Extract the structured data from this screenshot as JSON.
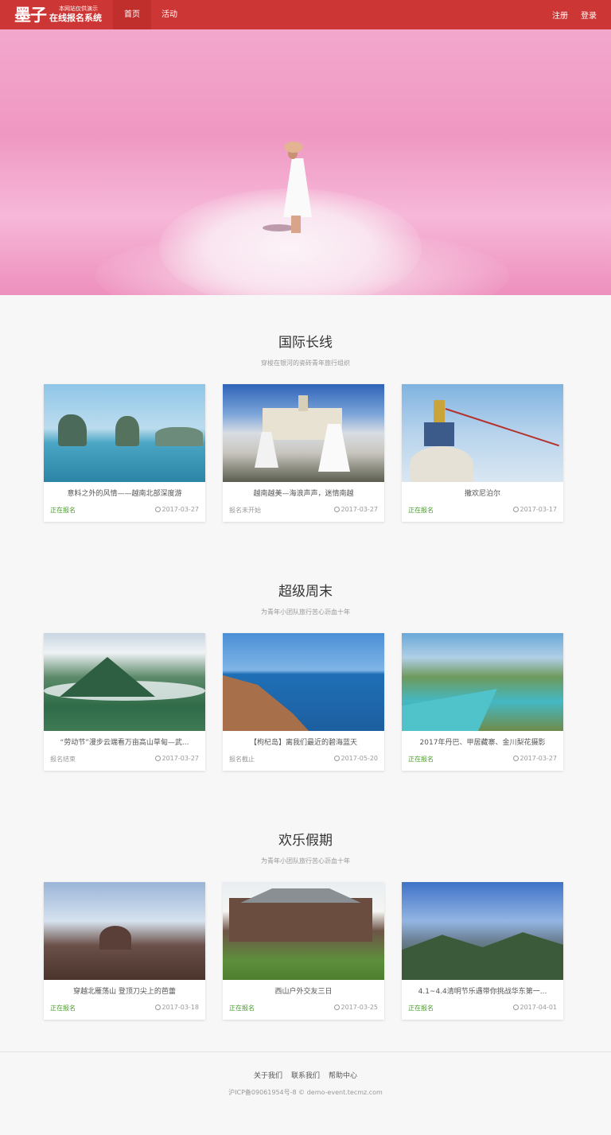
{
  "nav": {
    "logo": "墨子",
    "brand_small": "本网站仅供演示",
    "brand_big": "在线报名系统",
    "items": [
      {
        "label": "首页"
      },
      {
        "label": "活动"
      }
    ],
    "right": [
      {
        "label": "注册"
      },
      {
        "label": "登录"
      }
    ]
  },
  "colors": {
    "brand": "#cc3634",
    "status_open": "#4a9a2e",
    "status_closed": "#999999"
  },
  "sections": [
    {
      "title": "国际长线",
      "subtitle": "穿梭在银河的瓷砖青年旅行组织",
      "cards": [
        {
          "title": "意料之外的风情——越南北部深度游",
          "status": "正在报名",
          "date": "2017-03-27"
        },
        {
          "title": "越南越美—海浪声声，迷情南越",
          "status": "报名未开始",
          "date": "2017-03-27"
        },
        {
          "title": "撒欢尼泊尔",
          "status": "正在报名",
          "date": "2017-03-17"
        }
      ]
    },
    {
      "title": "超级周末",
      "subtitle": "为青年小团队旅行苦心沥血十年",
      "cards": [
        {
          "title": "“劳动节”漫步云端看万亩高山草甸—武...",
          "status": "报名结束",
          "date": "2017-03-27"
        },
        {
          "title": "【枸杞岛】离我们最近的碧海蓝天",
          "status": "报名截止",
          "date": "2017-05-20"
        },
        {
          "title": "2017年丹巴、甲居藏寨、金川梨花摄影",
          "status": "正在报名",
          "date": "2017-03-27"
        }
      ]
    },
    {
      "title": "欢乐假期",
      "subtitle": "为青年小团队旅行苦心沥血十年",
      "cards": [
        {
          "title": "穿越北雁荡山 登顶刀尖上的芭蕾",
          "status": "正在报名",
          "date": "2017-03-18"
        },
        {
          "title": "西山户外交友三日",
          "status": "正在报名",
          "date": "2017-03-25"
        },
        {
          "title": "4.1~4.4清明节乐遇带你挑战华东第一...",
          "status": "正在报名",
          "date": "2017-04-01"
        }
      ]
    }
  ],
  "footer": {
    "links": [
      {
        "label": "关于我们"
      },
      {
        "label": "联系我们"
      },
      {
        "label": "帮助中心"
      }
    ],
    "copyright": "沪ICP备09061954号-8 © demo-event.tecmz.com"
  }
}
